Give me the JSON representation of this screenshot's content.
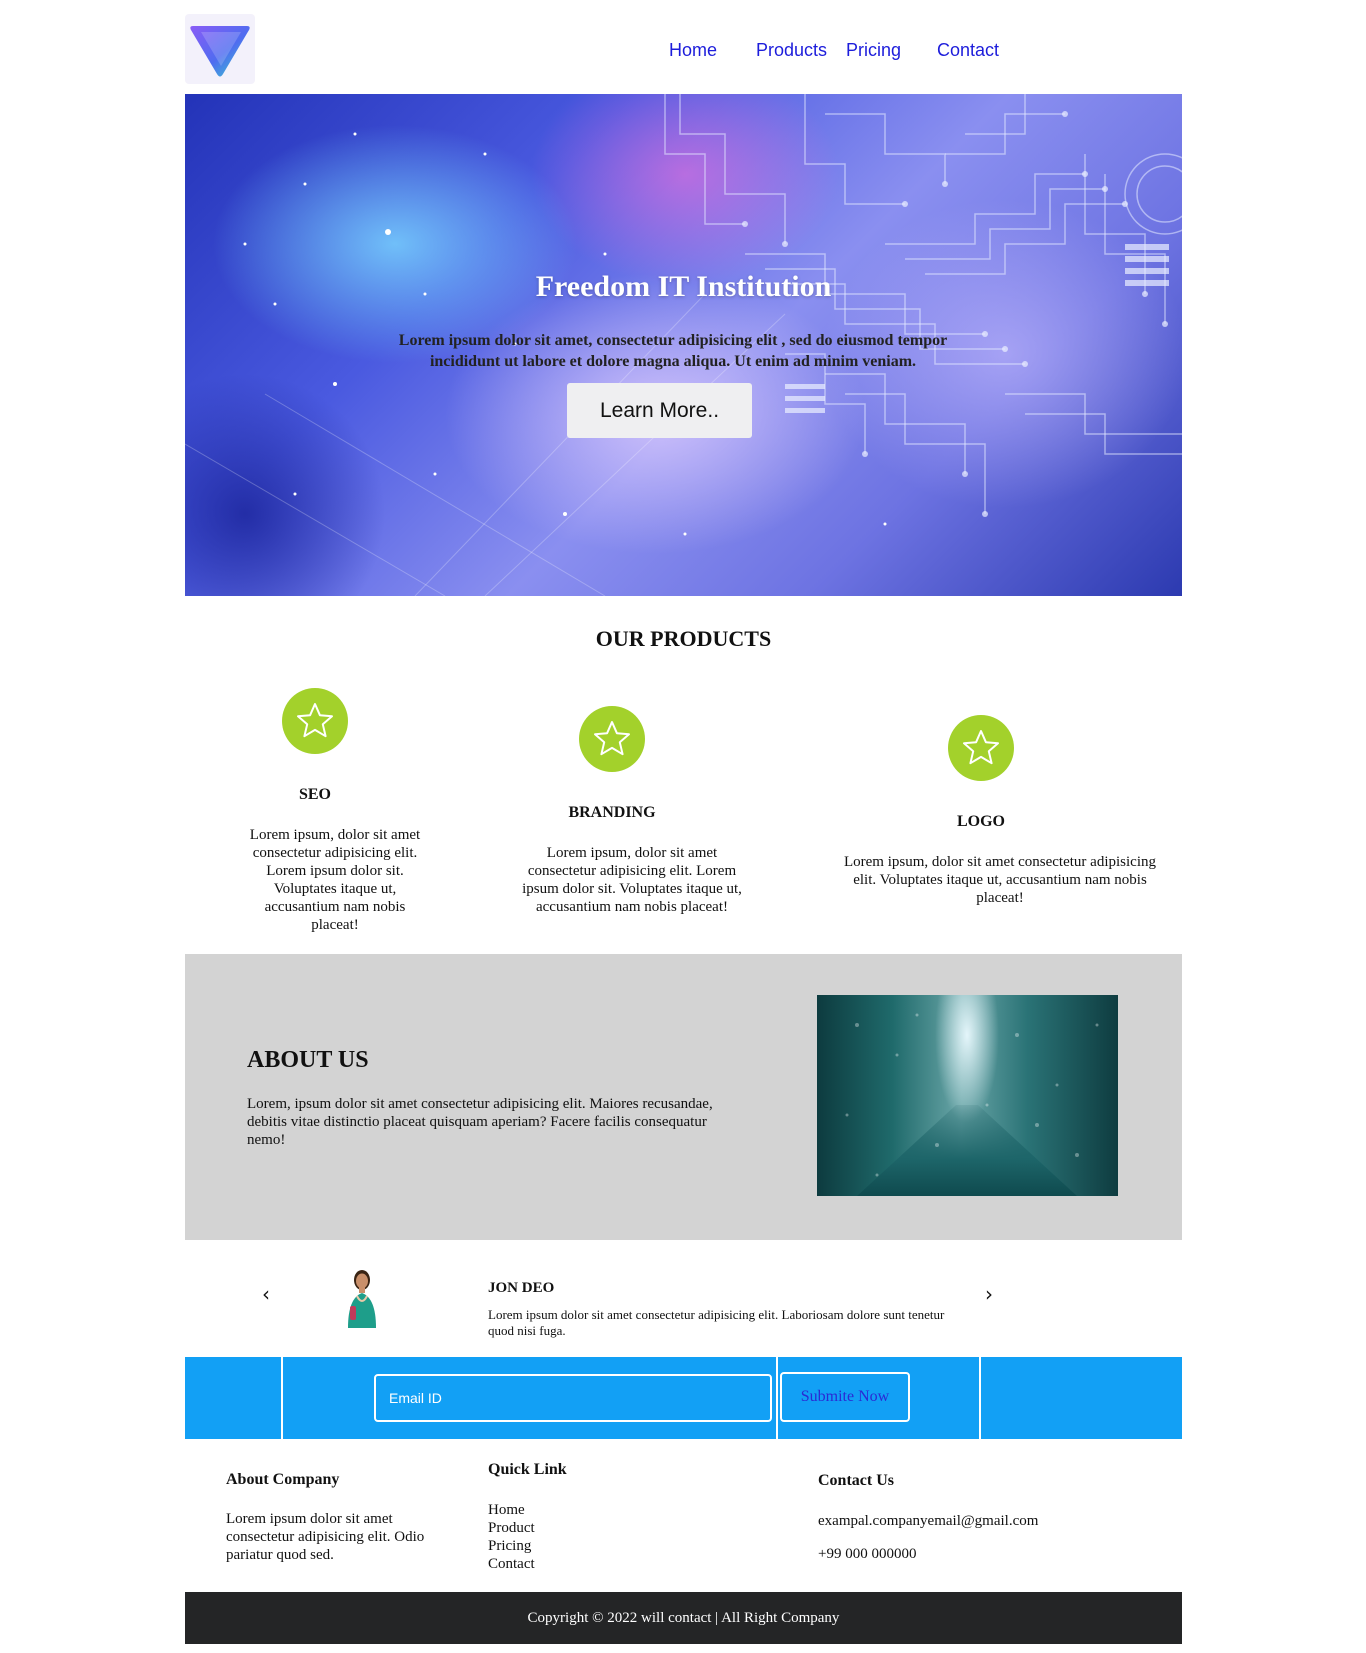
{
  "nav": {
    "home": "Home",
    "products": "Products",
    "pricing": "Pricing",
    "contact": "Contact"
  },
  "hero": {
    "title": "Freedom IT Institution",
    "text": "Lorem ipsum dolor sit amet, consectetur adipisicing elit , sed do eiusmod tempor incididunt ut labore et dolore magna aliqua. Ut enim ad minim veniam.",
    "button": "Learn More.."
  },
  "products": {
    "title": "OUR PRODUCTS",
    "items": [
      {
        "title": "SEO",
        "text": "Lorem ipsum, dolor sit amet consectetur adipisicing elit. Lorem ipsum dolor sit. Voluptates itaque ut, accusantium nam nobis placeat!"
      },
      {
        "title": "BRANDING",
        "text": "Lorem ipsum, dolor sit amet consectetur adipisicing elit. Lorem ipsum dolor sit. Voluptates itaque ut, accusantium nam nobis placeat!"
      },
      {
        "title": "LOGO",
        "text": "Lorem ipsum, dolor sit amet consectetur adipisicing elit. Voluptates itaque ut, accusantium nam nobis placeat!"
      }
    ],
    "icon": "star-icon",
    "icon_color": "#a3d12b"
  },
  "about": {
    "title": "ABOUT US",
    "text": "Lorem, ipsum dolor sit amet consectetur adipisicing elit. Maiores recusandae, debitis vitae distinctio placeat quisquam aperiam? Facere facilis consequatur nemo!"
  },
  "testimonial": {
    "name": "JON DEO",
    "text": "Lorem ipsum dolor sit amet consectetur adipisicing elit. Laboriosam dolore sunt tenetur quod nisi fuga.",
    "prev_icon": "chevron-left-icon",
    "next_icon": "chevron-right-icon"
  },
  "newsletter": {
    "email_placeholder": "Email ID",
    "submit": "Submite Now",
    "background": "#12a0f5"
  },
  "footer": {
    "about": {
      "title": "About Company",
      "text": "Lorem ipsum dolor sit amet consectetur adipisicing elit. Odio pariatur quod sed."
    },
    "quick": {
      "title": "Quick Link",
      "links": [
        "Home",
        "Product",
        "Pricing",
        "Contact"
      ]
    },
    "contact": {
      "title": "Contact Us",
      "email": "exampal.companyemail@gmail.com",
      "phone": "+99 000 000000"
    },
    "copyright": "Copyright © 2022 will contact | All Right Company"
  }
}
